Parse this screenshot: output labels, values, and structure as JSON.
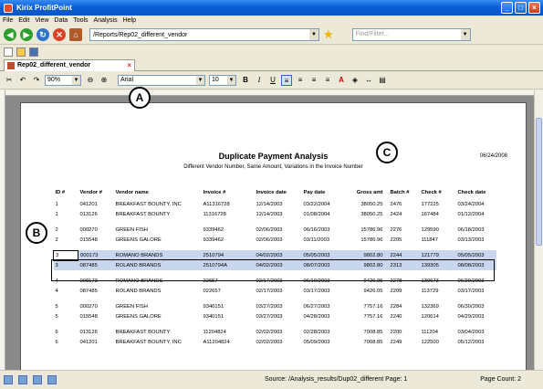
{
  "window": {
    "title": "Kirix ProfitPoint",
    "controls": [
      "_",
      "□",
      "×"
    ]
  },
  "menu": [
    "File",
    "Edit",
    "View",
    "Data",
    "Tools",
    "Analysis",
    "Help"
  ],
  "nav": {
    "url": "/Reports/Rep02_different_vendor",
    "find_placeholder": "Find/Filter..."
  },
  "tab": {
    "label": "Rep02_different_vendor"
  },
  "format": {
    "zoom": "90%",
    "font": "Arial",
    "size": "10",
    "bold": "B",
    "italic": "I",
    "underline": "U"
  },
  "callouts": {
    "a": "A",
    "b": "B",
    "c": "C"
  },
  "report": {
    "title": "Duplicate Payment Analysis",
    "subtitle": "Different Vendor Number, Same Amount, Variations in the Invoice Number",
    "date": "06/24/2008",
    "columns": [
      "ID #",
      "Vendor #",
      "Vendor name",
      "Invoice #",
      "Invoice date",
      "Pay date",
      "Gross amt",
      "Batch #",
      "Check #",
      "Check date"
    ],
    "groups": [
      [
        [
          "1",
          "041201",
          "BREAKFAST BOUNTY, INC",
          "A11316728",
          "12/14/2003",
          "03/22/2004",
          "38050.25",
          "2476",
          "177225",
          "03/24/2004"
        ],
        [
          "1",
          "013126",
          "BREAKFAST BOUNTY",
          "11316728",
          "12/14/2003",
          "01/08/2004",
          "38050.25",
          "2424",
          "167484",
          "01/12/2004"
        ]
      ],
      [
        [
          "2",
          "000270",
          "GREEN FISH",
          "9339462",
          "02/06/2003",
          "06/16/2003",
          "15786.96",
          "2276",
          "129590",
          "06/18/2003"
        ],
        [
          "2",
          "015548",
          "GREENS GALORE",
          "9339462",
          "02/06/2003",
          "03/11/2003",
          "15786.96",
          "2205",
          "111847",
          "03/13/2003"
        ]
      ],
      [
        [
          "3",
          "000173",
          "ROMANO BRANDS",
          "2510794",
          "04/02/2003",
          "05/05/2003",
          "9802.80",
          "2244",
          "121779",
          "05/05/2003"
        ],
        [
          "3",
          "087485",
          "ROLAND BRANDS",
          "2510794A",
          "04/02/2003",
          "08/07/2003",
          "9802.80",
          "2313",
          "139305",
          "08/08/2003"
        ]
      ],
      [
        [
          "4",
          "000173",
          "ROMANO BRANDS",
          "22657",
          "02/17/2003",
          "06/19/2003",
          "9426.05",
          "2278",
          "130673",
          "06/20/2003"
        ],
        [
          "4",
          "087485",
          "ROLAND BRANDS",
          "022657",
          "02/17/2003",
          "03/17/2003",
          "9426.05",
          "2209",
          "113729",
          "03/17/2003"
        ]
      ],
      [
        [
          "5",
          "000270",
          "GREEN FISH",
          "9340151",
          "03/27/2003",
          "06/27/2003",
          "7757.16",
          "2284",
          "132369",
          "06/30/2003"
        ],
        [
          "5",
          "015548",
          "GREENS GALORE",
          "9340151",
          "03/27/2003",
          "04/28/2003",
          "7757.16",
          "2240",
          "120614",
          "04/29/2003"
        ]
      ],
      [
        [
          "6",
          "013126",
          "BREAKFAST BOUNTY",
          "11204824",
          "02/02/2003",
          "02/28/2003",
          "7008.85",
          "2200",
          "111204",
          "03/04/2003"
        ],
        [
          "6",
          "041201",
          "BREAKFAST BOUNTY, INC",
          "A11204824",
          "02/02/2003",
          "05/09/2003",
          "7008.85",
          "2249",
          "122500",
          "05/12/2003"
        ]
      ]
    ]
  },
  "status": {
    "source": "Source: /Analysis_results/Dup02_different Page: 1",
    "page_count": "Page Count: 2"
  }
}
